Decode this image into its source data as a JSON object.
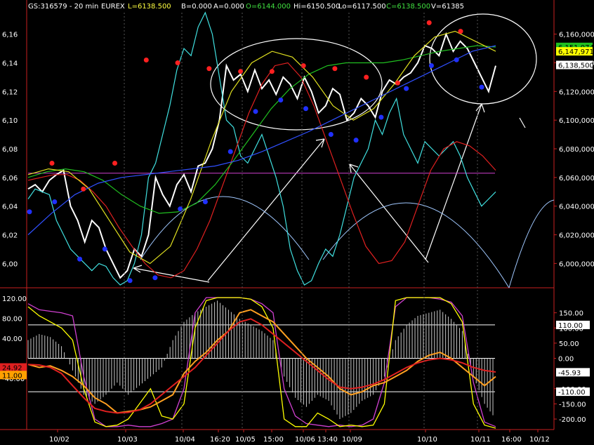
{
  "header": {
    "symbol": "GS:316579 - 20 min",
    "exchange": "EUREX",
    "last": "L=6138.500",
    "bid": "B=0.000",
    "ask": "A=0.000",
    "open": "O=6144.000",
    "high": "Hi=6150.500",
    "low": "Lo=6117.500",
    "close": "C=6138.500",
    "volume": "V=61385"
  },
  "colors": {
    "background": "#000000",
    "price": "#ffffff",
    "cyan_series": "#40e0e0",
    "red_ma": "#e02020",
    "green_ma": "#20c020",
    "yellow_ma": "#e0e020",
    "blue_ma": "#3050ff",
    "magenta_line": "#d040d0",
    "light_blue_arcs": "#a0c8ff",
    "high_marker": "#ff2020",
    "low_marker": "#2030ff"
  },
  "chart_data": [
    {
      "type": "line",
      "panel": "price",
      "y_axis_left_ticks": [
        "6,16",
        "6,14",
        "6,12",
        "6,10",
        "6,08",
        "6,06",
        "6,04",
        "6,02",
        "6,00"
      ],
      "y_axis_right_ticks": [
        "6,160,000",
        "6,140,000",
        "6,120,000",
        "6,100,000",
        "6,080,000",
        "6,060,000",
        "6,040,000",
        "6,020,000",
        "6,000,000"
      ],
      "ylim": [
        5985,
        6175
      ],
      "price_badges": [
        {
          "label": "6,151,074",
          "value": 6151.1,
          "color": "#20c020",
          "text_color": "#000000"
        },
        {
          "label": "6,147,971",
          "value": 6148.0,
          "color": "#ffff00",
          "text_color": "#000000"
        },
        {
          "label": "6,138,500",
          "value": 6138.5,
          "color": "#ffffff",
          "text_color": "#000000"
        }
      ],
      "horizontal_line": {
        "value": 6063,
        "color": "#d040d0"
      },
      "series": [
        {
          "name": "price",
          "color": "#ffffff",
          "values": [
            6052,
            6055,
            6050,
            6058,
            6062,
            6065,
            6040,
            6030,
            6015,
            6030,
            6025,
            6010,
            6000,
            5990,
            5995,
            6010,
            6005,
            6020,
            6060,
            6048,
            6040,
            6055,
            6062,
            6050,
            6068,
            6070,
            6080,
            6100,
            6138,
            6128,
            6132,
            6120,
            6135,
            6122,
            6128,
            6118,
            6130,
            6125,
            6115,
            6130,
            6120,
            6105,
            6110,
            6122,
            6118,
            6100,
            6105,
            6115,
            6110,
            6102,
            6120,
            6128,
            6125,
            6130,
            6133,
            6140,
            6152,
            6150,
            6145,
            6160,
            6148,
            6155,
            6150,
            6140,
            6130,
            6120,
            6138
          ]
        },
        {
          "name": "cyan",
          "color": "#40e0e0",
          "values": [
            6045,
            6052,
            6050,
            6048,
            6030,
            6020,
            6010,
            6005,
            6000,
            5995,
            6000,
            5998,
            5990,
            5985,
            5988,
            6000,
            6020,
            6060,
            6070,
            6090,
            6110,
            6135,
            6150,
            6145,
            6165,
            6175,
            6160,
            6130,
            6100,
            6095,
            6075,
            6070,
            6080,
            6090,
            6075,
            6060,
            6040,
            6010,
            5995,
            5985,
            5988,
            6000,
            6010,
            6005,
            6020,
            6040,
            6060,
            6070,
            6080,
            6100,
            6090,
            6105,
            6115,
            6090,
            6080,
            6070,
            6085,
            6080,
            6075,
            6080,
            6085,
            6075,
            6060,
            6050,
            6040,
            6045,
            6050
          ]
        },
        {
          "name": "red_ma",
          "color": "#e02020",
          "values": [
            6058,
            6060,
            6062,
            6062,
            6058,
            6050,
            6040,
            6025,
            6012,
            6000,
            5992,
            5990,
            5995,
            6010,
            6030,
            6055,
            6080,
            6105,
            6125,
            6138,
            6140,
            6130,
            6110,
            6085,
            6060,
            6035,
            6012,
            6000,
            6002,
            6015,
            6040,
            6065,
            6080,
            6085,
            6082,
            6075,
            6065
          ]
        },
        {
          "name": "green_ma",
          "color": "#20c020",
          "values": [
            6060,
            6064,
            6066,
            6064,
            6058,
            6048,
            6040,
            6035,
            6036,
            6042,
            6055,
            6072,
            6090,
            6108,
            6122,
            6132,
            6138,
            6140,
            6140,
            6140,
            6142,
            6145,
            6148,
            6150,
            6152,
            6151
          ]
        },
        {
          "name": "yellow_ma",
          "color": "#e0e020",
          "values": [
            6062,
            6066,
            6064,
            6052,
            6030,
            6008,
            6000,
            6012,
            6045,
            6085,
            6120,
            6140,
            6148,
            6144,
            6130,
            6110,
            6100,
            6108,
            6125,
            6145,
            6158,
            6162,
            6155,
            6148
          ]
        },
        {
          "name": "blue_ma",
          "color": "#3050ff",
          "values": [
            6020,
            6035,
            6048,
            6056,
            6060,
            6062,
            6064,
            6066,
            6068,
            6072,
            6078,
            6085,
            6092,
            6100,
            6108,
            6116,
            6124,
            6132,
            6140,
            6148,
            6152
          ]
        }
      ],
      "high_markers": [
        6068,
        6050,
        6068,
        6140,
        6138,
        6134,
        6132,
        6132,
        6136,
        6134,
        6128,
        6124,
        6166,
        6160
      ],
      "low_markers": [
        6038,
        6045,
        6005,
        6012,
        5990,
        5992,
        6040,
        6045,
        6080,
        6108,
        6116,
        6110,
        6092,
        6088,
        6104,
        6124,
        6140,
        6144,
        6125
      ]
    },
    {
      "type": "line",
      "panel": "oscillator",
      "y_axis_left_ticks": [
        "120.00",
        "80.00",
        "40.00",
        "-40.00"
      ],
      "y_axis_right_ticks": [
        "150.00",
        "100.00",
        "50.00",
        "0.00",
        "-100.00",
        "-150.00",
        "-200.00"
      ],
      "ylim": [
        -230,
        200
      ],
      "level_lines": [
        110,
        0,
        -110
      ],
      "badges": [
        {
          "label": "110.00",
          "value": 110,
          "side": "right",
          "color": "#ffffff",
          "text_color": "#000000"
        },
        {
          "label": "0.00",
          "value": 0,
          "side": "right",
          "color": "#000000",
          "text_color": "#ffffff"
        },
        {
          "label": "-45.93",
          "value": -45.93,
          "side": "right",
          "color": "#ffffff",
          "text_color": "#000000"
        },
        {
          "label": "-110.00",
          "value": -110,
          "side": "right",
          "color": "#ffffff",
          "text_color": "#000000"
        },
        {
          "label": "24.92",
          "value": -30,
          "side": "left",
          "color": "#e02020",
          "text_color": "#000000"
        },
        {
          "label": "11.00",
          "value": -55,
          "side": "left",
          "color": "#ffa000",
          "text_color": "#000000"
        }
      ],
      "series": [
        {
          "name": "magenta",
          "color": "#d040d0",
          "values": [
            180,
            160,
            155,
            150,
            140,
            -60,
            -200,
            -225,
            -225,
            -220,
            -225,
            -225,
            -215,
            -200,
            -100,
            150,
            200,
            200,
            200,
            200,
            195,
            180,
            150,
            -100,
            -190,
            -215,
            -220,
            -225,
            -220,
            -225,
            -220,
            -200,
            -80,
            170,
            200,
            200,
            200,
            195,
            185,
            140,
            -80,
            -210,
            -225
          ]
        },
        {
          "name": "yellow",
          "color": "#ffff00",
          "values": [
            170,
            140,
            120,
            100,
            60,
            -100,
            -210,
            -225,
            -220,
            -200,
            -150,
            -100,
            -190,
            -200,
            -150,
            100,
            190,
            200,
            200,
            200,
            195,
            170,
            100,
            -200,
            -225,
            -225,
            -180,
            -200,
            -225,
            -220,
            -225,
            -220,
            -150,
            190,
            200,
            200,
            200,
            200,
            180,
            120,
            -150,
            -220,
            -230
          ]
        },
        {
          "name": "orange",
          "color": "#ffa020",
          "values": [
            -20,
            -30,
            -25,
            -40,
            -60,
            -90,
            -130,
            -150,
            -180,
            -175,
            -170,
            -160,
            -140,
            -120,
            -50,
            -10,
            20,
            60,
            90,
            150,
            160,
            140,
            120,
            80,
            40,
            0,
            -30,
            -60,
            -100,
            -120,
            -110,
            -90,
            -80,
            -60,
            -40,
            -10,
            10,
            20,
            0,
            -30,
            -60,
            -90,
            -60
          ]
        },
        {
          "name": "red",
          "color": "#e02020",
          "values": [
            -20,
            -22,
            -30,
            -50,
            -90,
            -130,
            -165,
            -175,
            -180,
            -178,
            -170,
            -150,
            -120,
            -90,
            -60,
            -30,
            10,
            50,
            90,
            120,
            130,
            110,
            80,
            50,
            20,
            -10,
            -40,
            -70,
            -95,
            -100,
            -95,
            -85,
            -70,
            -50,
            -30,
            -15,
            -5,
            0,
            -5,
            -15,
            -30,
            -40,
            -45
          ]
        },
        {
          "name": "histogram",
          "color": "#c8c8c8",
          "values": [
            60,
            80,
            70,
            40,
            -40,
            -120,
            -150,
            -120,
            -80,
            -120,
            -90,
            -60,
            -30,
            60,
            120,
            150,
            170,
            190,
            160,
            130,
            110,
            90,
            60,
            -60,
            -130,
            -160,
            -120,
            -140,
            -200,
            -180,
            -140,
            -120,
            -60,
            60,
            110,
            140,
            150,
            160,
            130,
            90,
            -60,
            -150,
            -200
          ]
        }
      ]
    }
  ],
  "x_axis": {
    "labels": [
      "10/02",
      "10/03",
      "10/04",
      "16:20",
      "10/05",
      "15:00",
      "10/06",
      "13:40",
      "10/09",
      "10/10",
      "10/11",
      "16:00",
      "10/12"
    ]
  }
}
